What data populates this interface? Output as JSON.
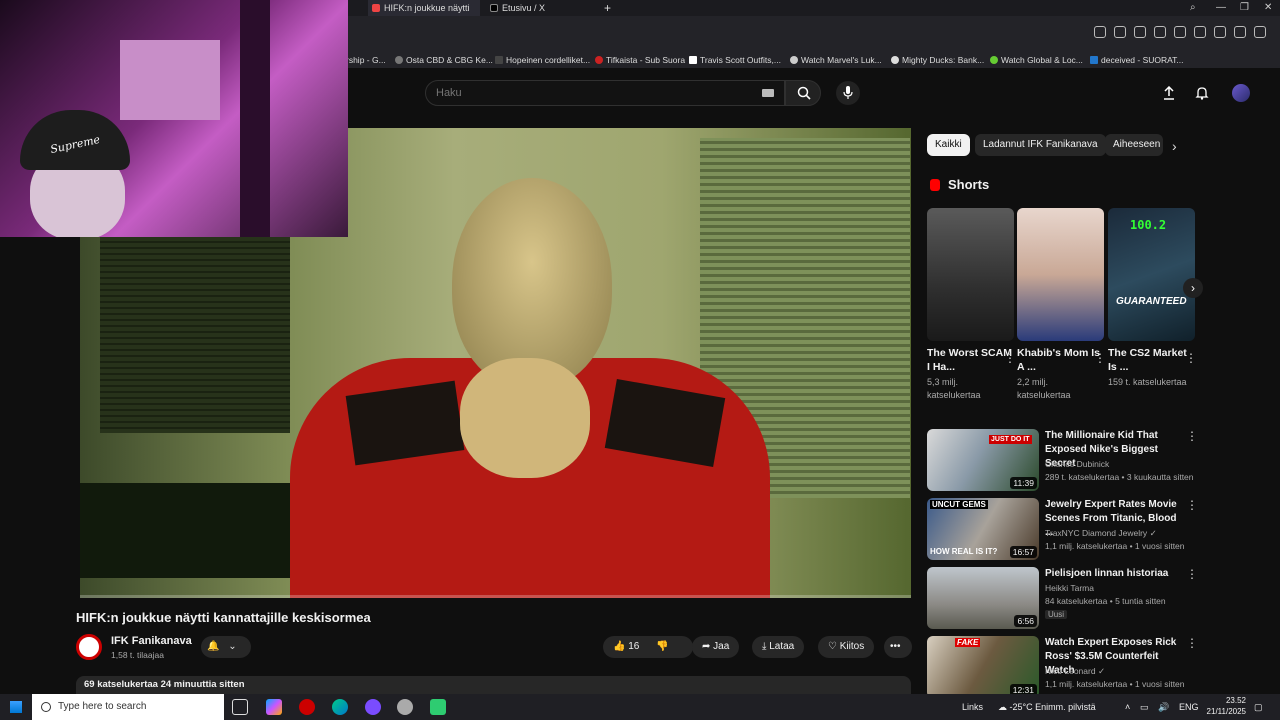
{
  "browser": {
    "tabs": [
      {
        "label": "HIFK:n joukkue näytti",
        "active": true
      },
      {
        "label": "Etusivu / X",
        "active": false
      }
    ],
    "bookmarks": [
      "rship - G...",
      "Osta CBD & CBG Ke...",
      "Hopeinen cordelliket...",
      "Tifkaista - Sub Suora",
      "Travis Scott Outfits,...",
      "Watch Marvel's Luk...",
      "Mighty Ducks: Bank...",
      "Watch Global & Loc...",
      "deceived - SUORAT..."
    ]
  },
  "header": {
    "search_placeholder": "Haku"
  },
  "video": {
    "title": "HIFK:n joukkue näytti kannattajille keskisormea",
    "channel": "IFK Fanikanava",
    "subscribers": "1,58 t. tilaajaa",
    "likes": "16",
    "share_label": "Jaa",
    "download_label": "Lataa",
    "thanks_label": "Kiitos",
    "more_label": "•••",
    "views_time": "69 katselukertaa  24 minuuttia sitten",
    "progress": 0.0
  },
  "webcam": {
    "hat_text": "Supreme"
  },
  "chips": [
    {
      "label": "Kaikki",
      "active": true
    },
    {
      "label": "Ladannut IFK Fanikanava",
      "active": false
    },
    {
      "label": "Aiheeseen",
      "active": false
    }
  ],
  "shorts": {
    "heading": "Shorts",
    "items": [
      {
        "title": "The Worst SCAM I Ha...",
        "views": "5,3 milj. katselukertaa"
      },
      {
        "title": "Khabib's Mom Is A ...",
        "views": "2,2 milj. katselukertaa"
      },
      {
        "title": "The CS2 Market Is ...",
        "views": "159 t. katselukertaa",
        "overlay_price": "100.2",
        "overlay_text": "GUARANTEED"
      }
    ]
  },
  "recommendations": [
    {
      "title": "The Millionaire Kid That Exposed Nike's Biggest Secret",
      "channel": "Chance Dubinick",
      "meta": "289 t. katselukertaa • 3 kuukautta sitten",
      "duration": "11:39",
      "thumb_text": "JUST DO IT"
    },
    {
      "title": "Jewelry Expert Rates Movie Scenes From Titanic, Blood ...",
      "channel": "TraxNYC Diamond Jewelry",
      "meta": "1,1 milj. katselukertaa • 1 vuosi sitten",
      "duration": "16:57",
      "thumb_top": "UNCUT GEMS",
      "thumb_bottom": "HOW REAL IS IT?"
    },
    {
      "title": "Pielisjoen linnan historiaa",
      "channel": "Heikki Tarma",
      "meta": "84 katselukertaa • 5 tuntia sitten",
      "badge": "Uusi",
      "duration": "6:56"
    },
    {
      "title": "Watch Expert Exposes Rick Ross' $3.5M Counterfeit Watch",
      "channel": "Nico Leonard",
      "meta": "1,1 milj. katselukertaa • 1 vuosi sitten",
      "duration": "12:31",
      "thumb_text": "FAKE"
    }
  ],
  "taskbar": {
    "search_placeholder": "Type here to search",
    "links": "Links",
    "weather": "-25°C  Enimm. pilvistä",
    "lang": "ENG",
    "time": "23.52",
    "date": "21/11/2025"
  }
}
